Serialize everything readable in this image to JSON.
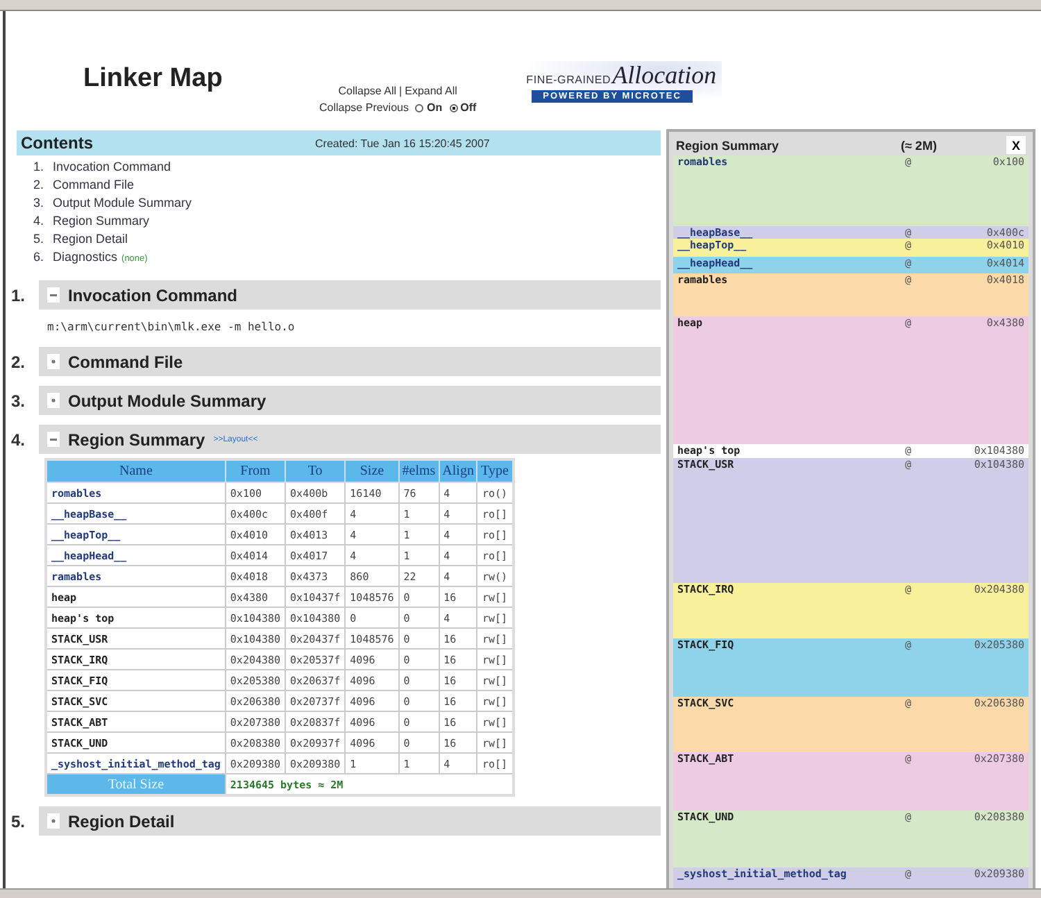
{
  "header": {
    "title": "Linker Map",
    "collapse_all": "Collapse All",
    "separator": "|",
    "expand_all": "Expand All",
    "collapse_previous": {
      "label": "Collapse Previous",
      "options": [
        {
          "label": "On",
          "selected": false
        },
        {
          "label": "Off",
          "selected": true
        }
      ]
    },
    "logo": {
      "tagline": "FINE-GRAINED",
      "script": "Allocation",
      "band": "POWERED BY MICROTEC"
    }
  },
  "contents": {
    "title": "Contents",
    "created": "Created: Tue Jan 16 15:20:45 2007",
    "items": [
      {
        "num": "1.",
        "label": "Invocation Command"
      },
      {
        "num": "2.",
        "label": "Command File"
      },
      {
        "num": "3.",
        "label": "Output Module Summary"
      },
      {
        "num": "4.",
        "label": "Region Summary"
      },
      {
        "num": "5.",
        "label": "Region Detail"
      },
      {
        "num": "6.",
        "label": "Diagnostics",
        "note": "(none)"
      }
    ]
  },
  "sections": [
    {
      "num": "1.",
      "title": "Invocation Command",
      "expanded": true,
      "kind": "command",
      "text": "m:\\arm\\current\\bin\\mlk.exe -m hello.o"
    },
    {
      "num": "2.",
      "title": "Command File",
      "expanded": false
    },
    {
      "num": "3.",
      "title": "Output Module Summary",
      "expanded": false
    },
    {
      "num": "4.",
      "title": "Region Summary",
      "expanded": true,
      "kind": "table",
      "link": ">>Layout<<"
    },
    {
      "num": "5.",
      "title": "Region Detail",
      "expanded": false
    }
  ],
  "table": {
    "columns": [
      "Name",
      "From",
      "To",
      "Size",
      "#elms",
      "Align",
      "Type"
    ],
    "rows": [
      {
        "kind": "symbol",
        "cells": [
          "romables",
          "0x100",
          "0x400b",
          "16140",
          "76",
          "4",
          "ro()"
        ]
      },
      {
        "kind": "symbol",
        "cells": [
          "__heapBase__",
          "0x400c",
          "0x400f",
          "4",
          "1",
          "4",
          "ro[]"
        ]
      },
      {
        "kind": "symbol",
        "cells": [
          "__heapTop__",
          "0x4010",
          "0x4013",
          "4",
          "1",
          "4",
          "ro[]"
        ]
      },
      {
        "kind": "symbol",
        "cells": [
          "__heapHead__",
          "0x4014",
          "0x4017",
          "4",
          "1",
          "4",
          "ro[]"
        ]
      },
      {
        "kind": "symbol",
        "cells": [
          "ramables",
          "0x4018",
          "0x4373",
          "860",
          "22",
          "4",
          "rw()"
        ]
      },
      {
        "kind": "region",
        "cells": [
          "heap",
          "0x4380",
          "0x10437f",
          "1048576",
          "0",
          "16",
          "rw[]"
        ]
      },
      {
        "kind": "region",
        "cells": [
          "heap's top",
          "0x104380",
          "0x104380",
          "0",
          "0",
          "4",
          "rw[]"
        ]
      },
      {
        "kind": "region",
        "cells": [
          "STACK_USR",
          "0x104380",
          "0x20437f",
          "1048576",
          "0",
          "16",
          "rw[]"
        ]
      },
      {
        "kind": "region",
        "cells": [
          "STACK_IRQ",
          "0x204380",
          "0x20537f",
          "4096",
          "0",
          "16",
          "rw[]"
        ]
      },
      {
        "kind": "region",
        "cells": [
          "STACK_FIQ",
          "0x205380",
          "0x20637f",
          "4096",
          "0",
          "16",
          "rw[]"
        ]
      },
      {
        "kind": "region",
        "cells": [
          "STACK_SVC",
          "0x206380",
          "0x20737f",
          "4096",
          "0",
          "16",
          "rw[]"
        ]
      },
      {
        "kind": "region",
        "cells": [
          "STACK_ABT",
          "0x207380",
          "0x20837f",
          "4096",
          "0",
          "16",
          "rw[]"
        ]
      },
      {
        "kind": "region",
        "cells": [
          "STACK_UND",
          "0x208380",
          "0x20937f",
          "4096",
          "0",
          "16",
          "rw[]"
        ]
      },
      {
        "kind": "symbol",
        "cells": [
          "_syshost_initial_method_tag",
          "0x209380",
          "0x209380",
          "1",
          "1",
          "4",
          "ro[]"
        ]
      }
    ],
    "total_label": "Total Size",
    "total_value": "2134645 bytes ≈ 2M"
  },
  "panel": {
    "title": "Region Summary",
    "size": "(≈ 2M)",
    "close": "X",
    "bands": [
      {
        "kind": "symbol",
        "name": "romables",
        "at": "@",
        "address": "0x100",
        "color": "#d5e8c8"
      },
      {
        "kind": "symbol",
        "name": "__heapBase__",
        "at": "@",
        "address": "0x400c",
        "color": "#cfcde8"
      },
      {
        "kind": "symbol",
        "name": "__heapTop__",
        "at": "@",
        "address": "0x4010",
        "color": "#f8f09a"
      },
      {
        "kind": "symbol",
        "name": "__heapHead__",
        "at": "@",
        "address": "0x4014",
        "color": "#8fd3ea"
      },
      {
        "kind": "region",
        "name": "ramables",
        "at": "@",
        "address": "0x4018",
        "color": "#fbd9a8"
      },
      {
        "kind": "region",
        "name": "heap",
        "at": "@",
        "address": "0x4380",
        "color": "#edcbe3"
      },
      {
        "kind": "region",
        "name": "heap's top",
        "at": "@",
        "address": "0x104380",
        "color": "#ffffff"
      },
      {
        "kind": "region",
        "name": "STACK_USR",
        "at": "@",
        "address": "0x104380",
        "color": "#cfcde8"
      },
      {
        "kind": "region",
        "name": "STACK_IRQ",
        "at": "@",
        "address": "0x204380",
        "color": "#f8f09a"
      },
      {
        "kind": "region",
        "name": "STACK_FIQ",
        "at": "@",
        "address": "0x205380",
        "color": "#8fd3ea"
      },
      {
        "kind": "region",
        "name": "STACK_SVC",
        "at": "@",
        "address": "0x206380",
        "color": "#fbd9a8"
      },
      {
        "kind": "region",
        "name": "STACK_ABT",
        "at": "@",
        "address": "0x207380",
        "color": "#edcbe3"
      },
      {
        "kind": "region",
        "name": "STACK_UND",
        "at": "@",
        "address": "0x208380",
        "color": "#d5e8c8"
      },
      {
        "kind": "symbol",
        "name": "_syshost_initial_method_tag",
        "at": "@",
        "address": "0x209380",
        "color": "#cfcde8"
      }
    ]
  }
}
